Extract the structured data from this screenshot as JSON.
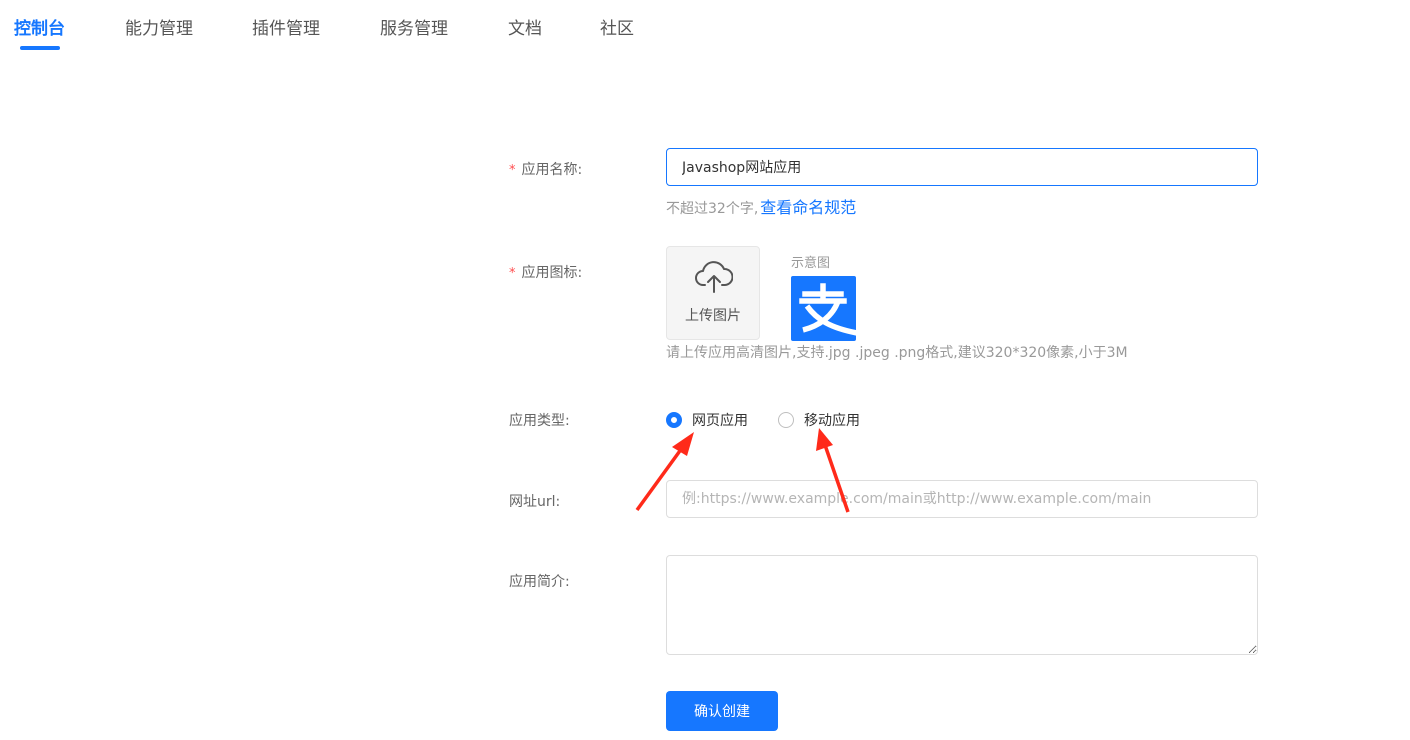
{
  "nav": {
    "tabs": [
      {
        "label": "控制台",
        "active": true
      },
      {
        "label": "能力管理"
      },
      {
        "label": "插件管理"
      },
      {
        "label": "服务管理"
      },
      {
        "label": "文档"
      },
      {
        "label": "社区"
      }
    ]
  },
  "form": {
    "name": {
      "label": "应用名称:",
      "value": "Javashop网站应用",
      "hint": "不超过32个字,",
      "hint_link": "查看命名规范"
    },
    "icon": {
      "label": "应用图标:",
      "upload_label": "上传图片",
      "example_label": "示意图",
      "hint": "请上传应用高清图片,支持.jpg .jpeg .png格式,建议320*320像素,小于3M"
    },
    "type": {
      "label": "应用类型:",
      "options": [
        {
          "label": "网页应用",
          "checked": true
        },
        {
          "label": "移动应用",
          "checked": false
        }
      ]
    },
    "url": {
      "label": "网址url:",
      "placeholder": "例:https://www.example.com/main或http://www.example.com/main"
    },
    "desc": {
      "label": "应用简介:"
    },
    "submit_label": "确认创建"
  },
  "icons": {
    "upload": "cloud-upload-icon",
    "example": "alipay-logo"
  },
  "colors": {
    "accent": "#1677ff",
    "required": "#ff4d4f",
    "annotation_arrow": "#ff2a1a"
  }
}
